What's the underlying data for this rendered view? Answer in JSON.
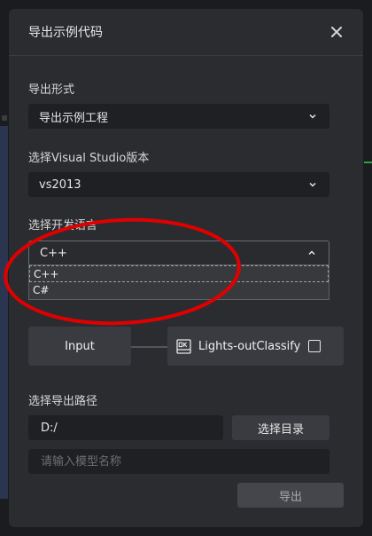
{
  "dialog": {
    "title": "导出示例代码"
  },
  "export_form": {
    "label": "导出形式",
    "value": "导出示例工程"
  },
  "vs_version": {
    "label": "选择Visual Studio版本",
    "value": "vs2013"
  },
  "language": {
    "label": "选择开发语言",
    "value": "C++",
    "options": [
      "C++",
      "C#"
    ]
  },
  "pipeline": {
    "input_label": "Input",
    "classify_label": "Lights-outClassify"
  },
  "export_path": {
    "label": "选择导出路径",
    "value": "D:/",
    "browse_label": "选择目录"
  },
  "model_name": {
    "placeholder": "请输入模型名称"
  },
  "export_button": {
    "label": "导出"
  },
  "colors": {
    "annotation": "#e00000",
    "background": "#2b2c30"
  }
}
